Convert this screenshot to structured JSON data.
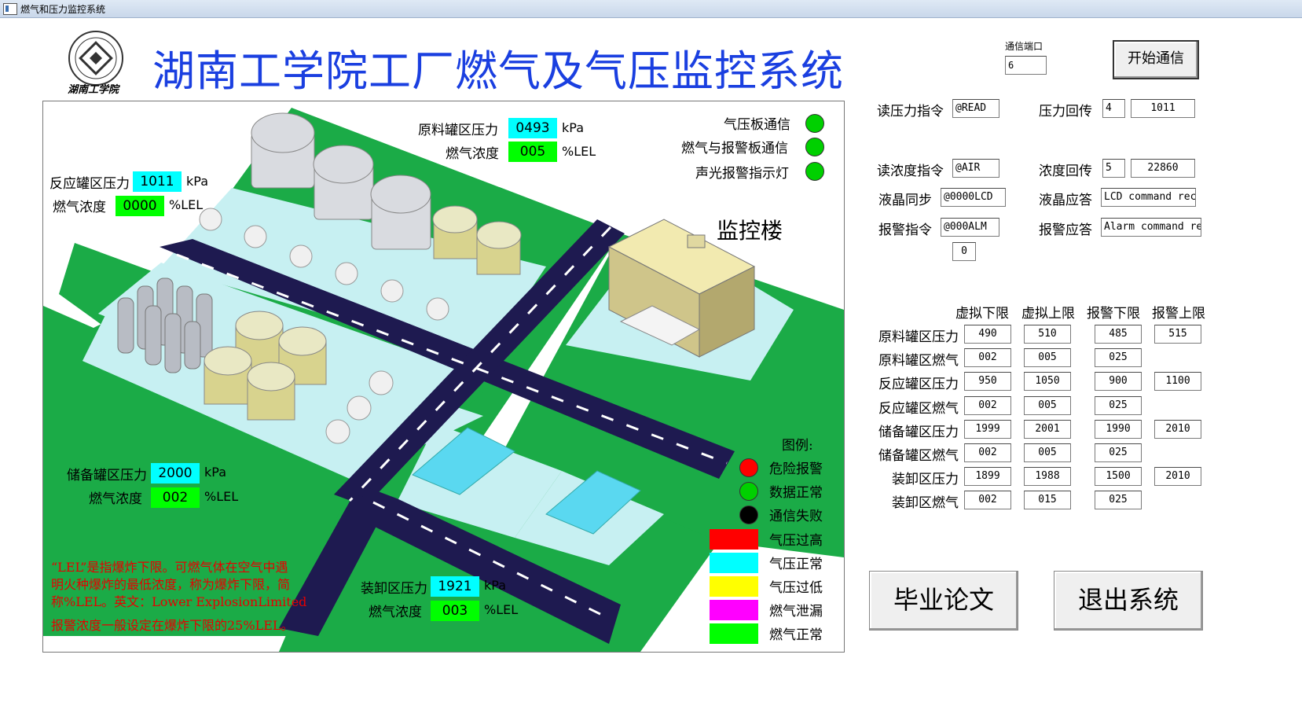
{
  "window": {
    "title": "燃气和压力监控系统"
  },
  "header": {
    "title": "湖南工学院工厂燃气及气压监控系统",
    "logo_caption": "湖南工学院"
  },
  "comm": {
    "port_label": "通信端口",
    "port_value": "6",
    "start_button": "开始通信"
  },
  "scene": {
    "raw_tank": {
      "pressure_label": "原料罐区压力",
      "pressure": "0493",
      "pressure_unit": "kPa",
      "gas_label": "燃气浓度",
      "gas": "005",
      "gas_unit": "%LEL"
    },
    "reaction_tank": {
      "pressure_label": "反应罐区压力",
      "pressure": "1011",
      "pressure_unit": "kPa",
      "gas_label": "燃气浓度",
      "gas": "0000",
      "gas_unit": "%LEL"
    },
    "storage_tank": {
      "pressure_label": "储备罐区压力",
      "pressure": "2000",
      "pressure_unit": "kPa",
      "gas_label": "燃气浓度",
      "gas": "002",
      "gas_unit": "%LEL"
    },
    "unloading": {
      "pressure_label": "装卸区压力",
      "pressure": "1921",
      "pressure_unit": "kPa",
      "gas_label": "燃气浓度",
      "gas": "003",
      "gas_unit": "%LEL"
    },
    "indicators": [
      {
        "label": "气压板通信",
        "color": "#00d000"
      },
      {
        "label": "燃气与报警板通信",
        "color": "#00d000"
      },
      {
        "label": "声光报警指示灯",
        "color": "#00d000"
      }
    ],
    "building_label": "监控楼",
    "legend": {
      "title": "图例:",
      "dots": [
        {
          "label": "危险报警",
          "color": "#ff0000"
        },
        {
          "label": "数据正常",
          "color": "#00d000"
        },
        {
          "label": "通信失败",
          "color": "#000000"
        }
      ],
      "swatches": [
        {
          "label": "气压过高",
          "color": "#ff0000"
        },
        {
          "label": "气压正常",
          "color": "#00ffff"
        },
        {
          "label": "气压过低",
          "color": "#ffff00"
        },
        {
          "label": "燃气泄漏",
          "color": "#ff00ff"
        },
        {
          "label": "燃气正常",
          "color": "#00ff00"
        }
      ]
    },
    "note": {
      "line1": "“LEL”是指爆炸下限。可燃气体在空气中遇",
      "line2": "明火种爆炸的最低浓度，称为爆炸下限，简",
      "line3": "称%LEL。英文：Lower ExplosionLimited",
      "line4": "报警浓度一般设定在爆炸下限的25%LEL。"
    }
  },
  "commands": {
    "read_pressure_label": "读压力指令",
    "read_pressure_cmd": "@READ",
    "pressure_echo_label": "压力回传",
    "pressure_echo_a": "4",
    "pressure_echo_b": "1011",
    "read_gas_label": "读浓度指令",
    "read_gas_cmd": "@AIR",
    "gas_echo_label": "浓度回传",
    "gas_echo_a": "5",
    "gas_echo_b": "22860",
    "lcd_sync_label": "液晶同步",
    "lcd_sync_cmd": "@0000LCD",
    "lcd_reply_label": "液晶应答",
    "lcd_reply": "LCD command rece",
    "alarm_cmd_label": "报警指令",
    "alarm_cmd": "@000ALM",
    "alarm_value": "0",
    "alarm_reply_label": "报警应答",
    "alarm_reply": "Alarm command rec"
  },
  "limits": {
    "headers": [
      "虚拟下限",
      "虚拟上限",
      "报警下限",
      "报警上限"
    ],
    "rows": [
      {
        "label": "原料罐区压力",
        "v": [
          "490",
          "510",
          "485",
          "515"
        ]
      },
      {
        "label": "原料罐区燃气",
        "v": [
          "002",
          "005",
          "025",
          ""
        ]
      },
      {
        "label": "反应罐区压力",
        "v": [
          "950",
          "1050",
          "900",
          "1100"
        ]
      },
      {
        "label": "反应罐区燃气",
        "v": [
          "002",
          "005",
          "025",
          ""
        ]
      },
      {
        "label": "储备罐区压力",
        "v": [
          "1999",
          "2001",
          "1990",
          "2010"
        ]
      },
      {
        "label": "储备罐区燃气",
        "v": [
          "002",
          "005",
          "025",
          ""
        ]
      },
      {
        "label": "装卸区压力",
        "v": [
          "1899",
          "1988",
          "1500",
          "2010"
        ]
      },
      {
        "label": "装卸区燃气",
        "v": [
          "002",
          "015",
          "025",
          ""
        ]
      }
    ]
  },
  "footer": {
    "thesis_button": "毕业论文",
    "exit_button": "退出系统"
  }
}
